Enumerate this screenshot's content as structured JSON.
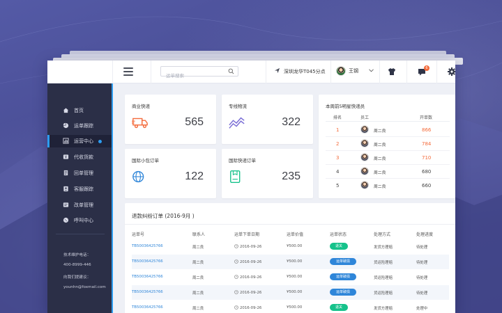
{
  "colors": {
    "accent_blue": "#2c9cf0",
    "sidebar_bg": "#2b2f47",
    "backdrop_purple": "#4a4d94",
    "icon_orange": "#f46b3b",
    "icon_purple": "#7b6fd6",
    "icon_blue": "#2f86d9",
    "icon_green": "#16c28b",
    "rank_top3_orange": "#f46b3b"
  },
  "topbar": {
    "menu_icon": "hamburger-icon",
    "search_placeholder": "运单搜索",
    "branch_name": "深圳龙华T045分点",
    "user_name": "王钢",
    "notification_count": "6",
    "icons": [
      "shirt-icon",
      "message-icon",
      "gear-icon"
    ]
  },
  "sidebar": {
    "items": [
      {
        "label": "首页",
        "icon": "home-icon",
        "active": false
      },
      {
        "label": "运单跟踪",
        "icon": "pie-icon",
        "active": false
      },
      {
        "label": "运营中心",
        "icon": "chart-icon",
        "active": true
      },
      {
        "label": "代收货款",
        "icon": "money-icon",
        "active": false
      },
      {
        "label": "回单管理",
        "icon": "receipt-icon",
        "active": false
      },
      {
        "label": "客服跟踪",
        "icon": "contacts-icon",
        "active": false
      },
      {
        "label": "改单管理",
        "icon": "edit-icon",
        "active": false
      },
      {
        "label": "呼叫中心",
        "icon": "phone-icon",
        "active": false
      }
    ],
    "info": {
      "hotline_label": "技术维护电话：",
      "hotline_number": "400-8999-446",
      "suggest_label": "向我们提建议：",
      "email": "younhn@foxmail.com"
    }
  },
  "stats": [
    {
      "title": "商业快递",
      "value": "565",
      "icon": "truck-icon"
    },
    {
      "title": "专线物流",
      "value": "322",
      "icon": "trend-icon"
    },
    {
      "title": "国际小包订单",
      "value": "122",
      "icon": "globe-icon"
    },
    {
      "title": "国际快递订单",
      "value": "235",
      "icon": "package-icon"
    }
  ],
  "ranking": {
    "title": "本周前5明星快递员",
    "headers": [
      "排名",
      "员工",
      "开单数"
    ],
    "rows": [
      {
        "rank": "1",
        "name": "周二良",
        "count": "866"
      },
      {
        "rank": "2",
        "name": "周二良",
        "count": "784"
      },
      {
        "rank": "3",
        "name": "周二良",
        "count": "710"
      },
      {
        "rank": "4",
        "name": "周二良",
        "count": "680"
      },
      {
        "rank": "5",
        "name": "周二良",
        "count": "660"
      }
    ]
  },
  "orders": {
    "title": "退款纠纷订单 (2016-9月 )",
    "headers": [
      "运单号",
      "联系人",
      "运单下单日期",
      "运单价值",
      "运单状态",
      "处理方式",
      "处理进度"
    ],
    "rows": [
      {
        "id": "TB50036425766",
        "contact": "周二良",
        "date": "2016-09-26",
        "value": "¥500.00",
        "status": "退关",
        "status_color": "green",
        "method": "发货方理赔",
        "progress": "待处理"
      },
      {
        "id": "TB50036425766",
        "contact": "周二良",
        "date": "2016-09-26",
        "value": "¥500.00",
        "status": "运单破损",
        "status_color": "blue",
        "method": "货运险理赔",
        "progress": "待处理"
      },
      {
        "id": "TB50036425766",
        "contact": "周二良",
        "date": "2016-09-26",
        "value": "¥500.00",
        "status": "运单破损",
        "status_color": "blue",
        "method": "货运险理赔",
        "progress": "待处理"
      },
      {
        "id": "TB50036425766",
        "contact": "周二良",
        "date": "2016-09-26",
        "value": "¥500.00",
        "status": "运单破损",
        "status_color": "blue",
        "method": "货运险理赔",
        "progress": "待处理"
      },
      {
        "id": "TB50036425766",
        "contact": "周二良",
        "date": "2016-09-26",
        "value": "¥500.00",
        "status": "退关",
        "status_color": "green",
        "method": "发货方理赔",
        "progress": "处理中"
      }
    ]
  }
}
